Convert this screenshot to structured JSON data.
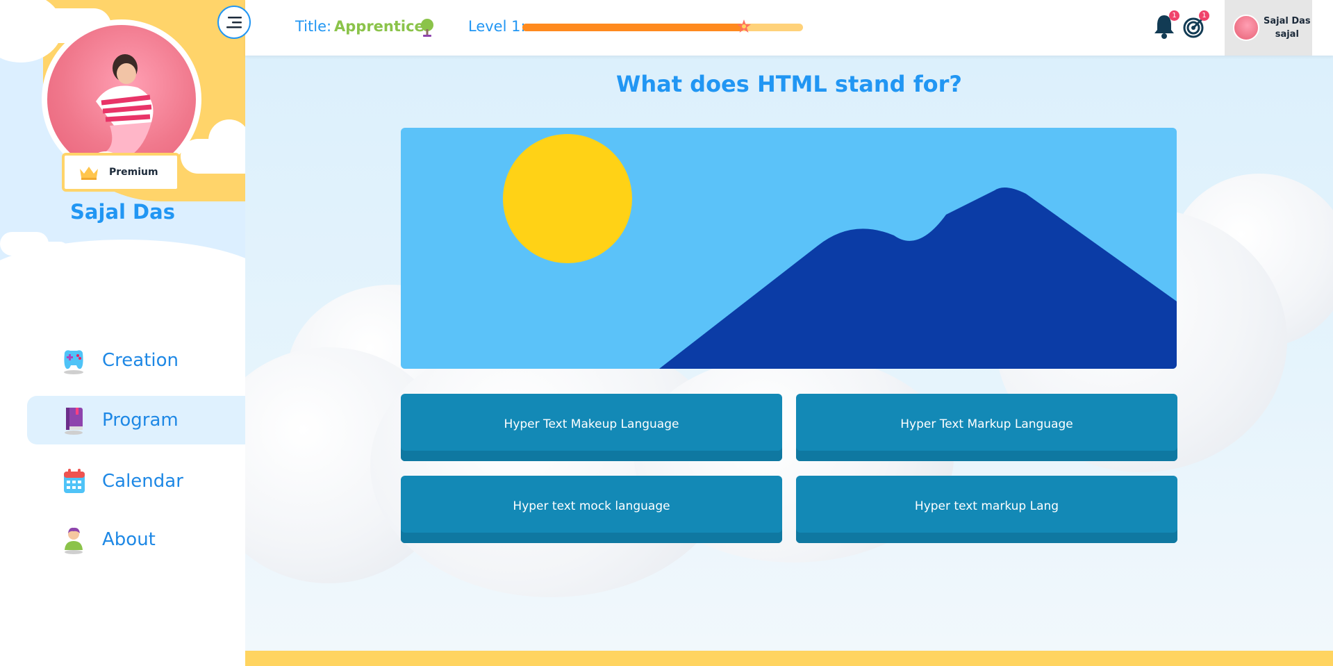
{
  "sidebar": {
    "profile_name": "Sajal Das",
    "badge_label": "Premium",
    "nav": [
      {
        "label": "Creation",
        "icon": "gamepad-icon",
        "active": false
      },
      {
        "label": "Program",
        "icon": "book-icon",
        "active": true
      },
      {
        "label": "Calendar",
        "icon": "calendar-icon",
        "active": false
      },
      {
        "label": "About",
        "icon": "person-icon",
        "active": false
      }
    ]
  },
  "header": {
    "title_label": "Title:",
    "title_value": "Apprentice",
    "level_label": "Level 1:",
    "level_progress": 0.79,
    "notifications_count": "1",
    "targets_count": "1",
    "user": {
      "name": "Sajal Das",
      "username": "sajal"
    }
  },
  "quiz": {
    "question": "What does HTML stand for?",
    "answers": [
      "Hyper Text Makeup Language",
      "Hyper Text Markup Language",
      "Hyper text mock language",
      "Hyper text markup Lang"
    ]
  },
  "colors": {
    "accent": "#2196f3",
    "title_green": "#8bc34a",
    "answer_bg": "#1389b6",
    "progress_fill": "#ff8a1e",
    "sidebar_yellow": "#ffd46a"
  }
}
